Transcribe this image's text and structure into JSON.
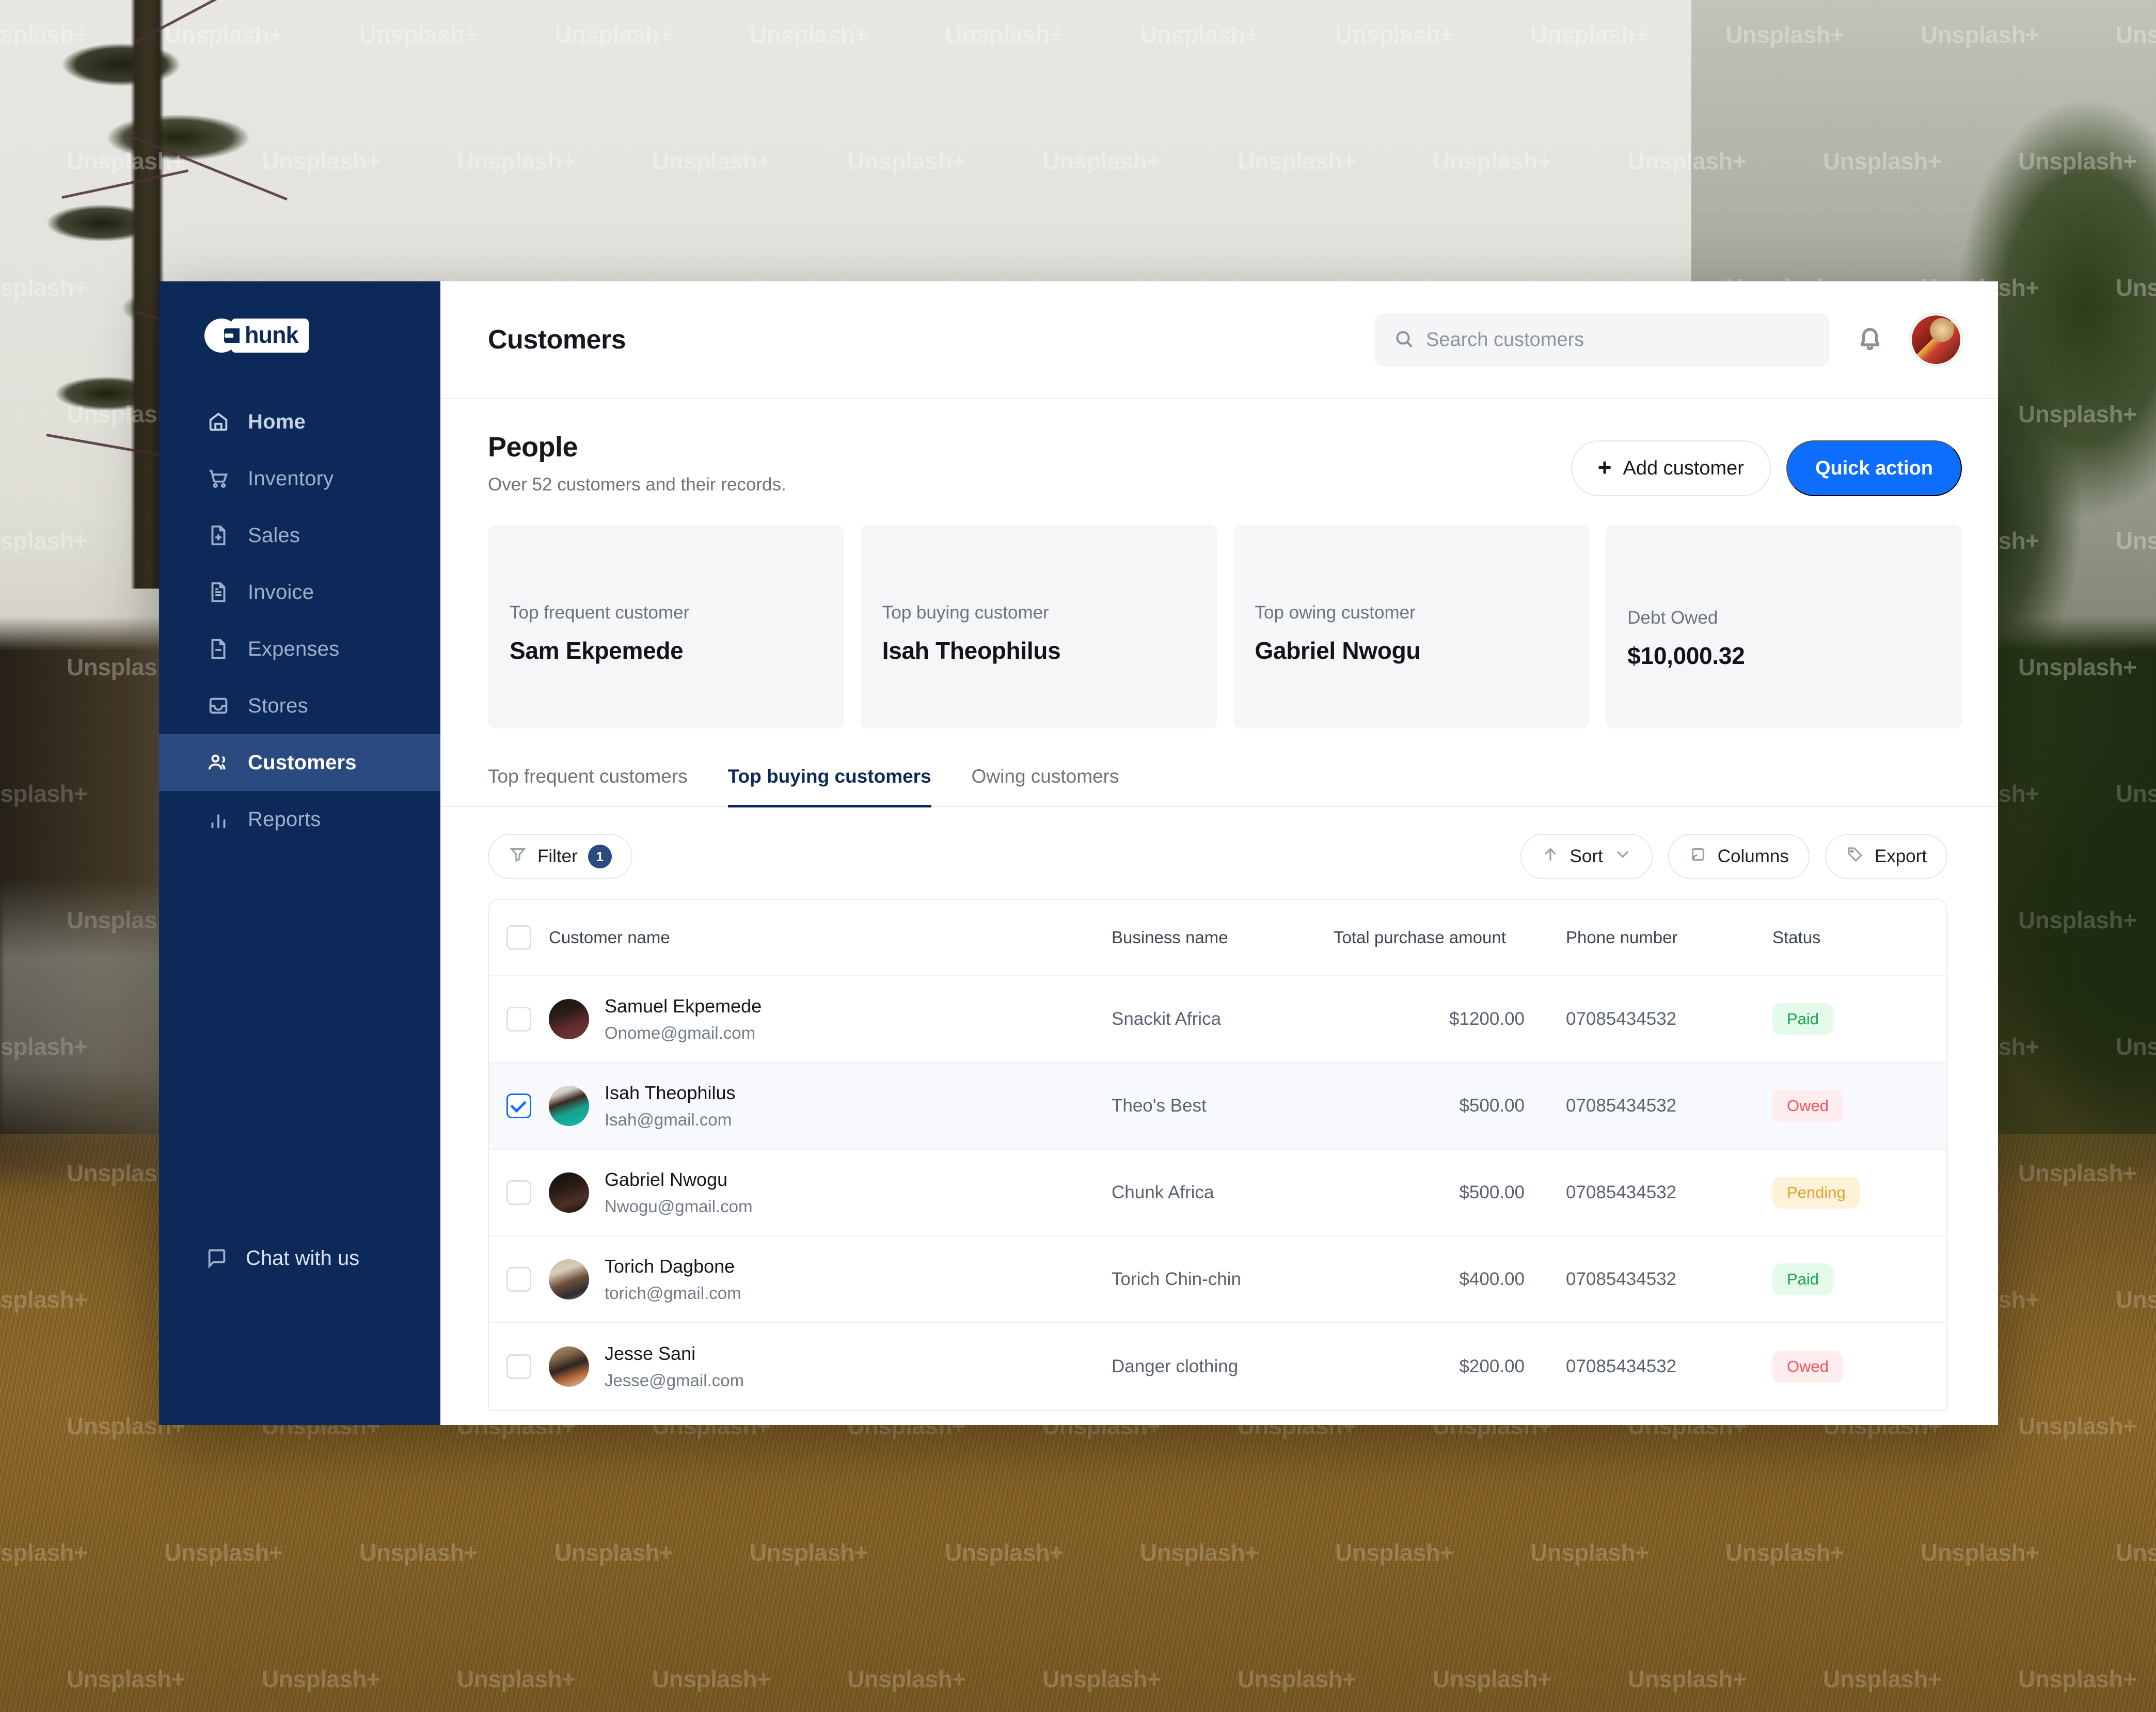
{
  "background": {
    "watermark_text": "Unsplash+"
  },
  "sidebar": {
    "logo": {
      "mark": "C",
      "text": "hunk"
    },
    "items": [
      {
        "label": "Home",
        "icon": "home-icon",
        "active": false
      },
      {
        "label": "Inventory",
        "icon": "cart-icon",
        "active": false
      },
      {
        "label": "Sales",
        "icon": "file-plus-icon",
        "active": false
      },
      {
        "label": "Invoice",
        "icon": "file-text-icon",
        "active": false
      },
      {
        "label": "Expenses",
        "icon": "file-minus-icon",
        "active": false
      },
      {
        "label": "Stores",
        "icon": "inbox-icon",
        "active": false
      },
      {
        "label": "Customers",
        "icon": "users-icon",
        "active": true
      },
      {
        "label": "Reports",
        "icon": "bar-chart-icon",
        "active": false
      }
    ],
    "chat": {
      "label": "Chat with us",
      "icon": "chat-bubble-icon"
    }
  },
  "topbar": {
    "title": "Customers",
    "search": {
      "value": "",
      "placeholder": "Search customers",
      "icon": "search-icon"
    },
    "bell_icon": "bell-icon",
    "avatar": "user-avatar"
  },
  "page": {
    "title": "People",
    "subtitle": "Over 52 customers and their records.",
    "add_customer_label": "Add customer",
    "quick_action_label": "Quick action"
  },
  "cards": [
    {
      "label": "Top frequent customer",
      "value": "Sam Ekpemede"
    },
    {
      "label": "Top buying customer",
      "value": "Isah Theophilus"
    },
    {
      "label": "Top owing customer",
      "value": "Gabriel Nwogu"
    },
    {
      "label": "Debt Owed",
      "value": "$10,000.32"
    }
  ],
  "tabs": [
    {
      "label": "Top frequent customers",
      "active": false
    },
    {
      "label": "Top buying customers",
      "active": true
    },
    {
      "label": "Owing customers",
      "active": false
    }
  ],
  "toolbar": {
    "filter_label": "Filter",
    "filter_count": "1",
    "sort_label": "Sort",
    "columns_label": "Columns",
    "export_label": "Export"
  },
  "table": {
    "columns": [
      "Customer name",
      "Business name",
      "Total purchase amount",
      "Phone number",
      "Status"
    ],
    "rows": [
      {
        "name": "Samuel Ekpemede",
        "email": "Onome@gmail.com",
        "business": "Snackit Africa",
        "amount": "$1200.00",
        "phone": "07085434532",
        "status": "Paid",
        "status_type": "paid",
        "selected": false
      },
      {
        "name": "Isah Theophilus",
        "email": "Isah@gmail.com",
        "business": "Theo's Best",
        "amount": "$500.00",
        "phone": "07085434532",
        "status": "Owed",
        "status_type": "owed",
        "selected": true
      },
      {
        "name": "Gabriel Nwogu",
        "email": "Nwogu@gmail.com",
        "business": "Chunk Africa",
        "amount": "$500.00",
        "phone": "07085434532",
        "status": "Pending",
        "status_type": "pending",
        "selected": false
      },
      {
        "name": "Torich Dagbone",
        "email": "torich@gmail.com",
        "business": "Torich Chin-chin",
        "amount": "$400.00",
        "phone": "07085434532",
        "status": "Paid",
        "status_type": "paid",
        "selected": false
      },
      {
        "name": "Jesse Sani",
        "email": "Jesse@gmail.com",
        "business": "Danger clothing",
        "amount": "$200.00",
        "phone": "07085434532",
        "status": "Owed",
        "status_type": "owed",
        "selected": false
      }
    ]
  },
  "colors": {
    "sidebar_bg": "#0c2959",
    "sidebar_active": "#2b4a80",
    "primary": "#0d6efd",
    "paid": "#17a34a",
    "owed": "#f0555a",
    "pending": "#e2a133"
  }
}
